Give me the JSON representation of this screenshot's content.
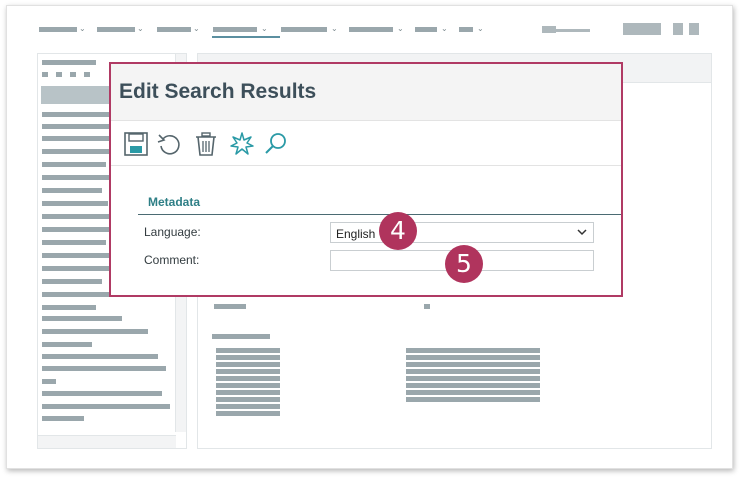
{
  "dialog": {
    "title": "Edit Search Results",
    "toolbar": [
      {
        "icon": "save-icon"
      },
      {
        "icon": "undo-icon"
      },
      {
        "icon": "delete-icon"
      },
      {
        "icon": "sparkle-icon"
      },
      {
        "icon": "search-icon"
      }
    ],
    "section_title": "Metadata",
    "language": {
      "label": "Language:",
      "value": "English"
    },
    "comment": {
      "label": "Comment:",
      "value": ""
    }
  },
  "callouts": {
    "language_step": "4",
    "comment_step": "5"
  },
  "colors": {
    "accent": "#b03a64",
    "badge": "#b0345d",
    "section_title": "#2e7f86",
    "title_text": "#3d4f5a",
    "icon_dark": "#55656c",
    "icon_teal": "#2a9aa6"
  }
}
